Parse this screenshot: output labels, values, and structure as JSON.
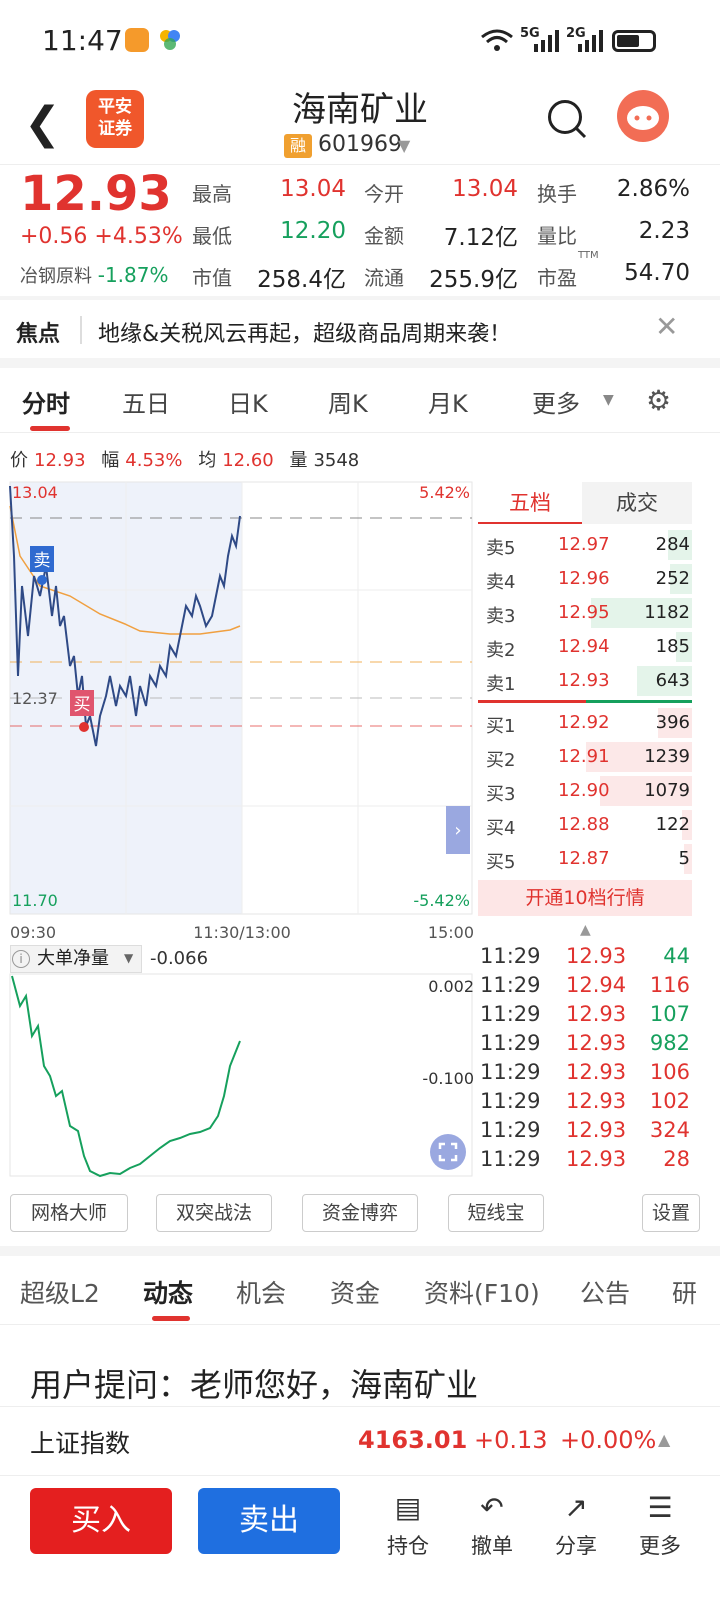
{
  "status": {
    "time": "11:47",
    "net1": "5G",
    "net2": "2G"
  },
  "header": {
    "logo_line1": "平安",
    "logo_line2": "证券",
    "title": "海南矿业",
    "rong": "融",
    "code": "601969"
  },
  "quote": {
    "price": "12.93",
    "change": "+0.56",
    "change_pct": "+4.53%",
    "sector_name": "冶钢原料",
    "sector_chg": "-1.87%",
    "high_label": "最高",
    "high": "13.04",
    "open_label": "今开",
    "open": "13.04",
    "turnover_label": "换手",
    "turnover": "2.86%",
    "low_label": "最低",
    "low": "12.20",
    "amount_label": "金额",
    "amount": "7.12亿",
    "vol_ratio_label": "量比",
    "vol_ratio": "2.23",
    "mcap_label": "市值",
    "mcap": "258.4亿",
    "float_label": "流通",
    "float": "255.9亿",
    "pe_label": "市盈",
    "pe_sup": "TTM",
    "pe": "54.70"
  },
  "news": {
    "label": "焦点",
    "text": "地缘&关税风云再起，超级商品周期来袭！"
  },
  "chart_tabs": [
    "分时",
    "五日",
    "日K",
    "周K",
    "月K",
    "更多"
  ],
  "info_row": {
    "price_label": "价",
    "price": "12.93",
    "amp_label": "幅",
    "amp": "4.53%",
    "avg_label": "均",
    "avg": "12.60",
    "vol_label": "量",
    "vol": "3548"
  },
  "chart_labels": {
    "top_price": "13.04",
    "top_pct": "5.42%",
    "mid_price": "12.37",
    "bottom_price": "11.70",
    "bottom_pct": "-5.42%",
    "t_start": "09:30",
    "t_mid": "11:30/13:00",
    "t_end": "15:00",
    "sell_mark": "卖",
    "buy_mark": "买"
  },
  "orderbook": {
    "tab_levels": "五档",
    "tab_trades": "成交",
    "asks": [
      {
        "label": "卖5",
        "price": "12.97",
        "vol": "284"
      },
      {
        "label": "卖4",
        "price": "12.96",
        "vol": "252"
      },
      {
        "label": "卖3",
        "price": "12.95",
        "vol": "1182"
      },
      {
        "label": "卖2",
        "price": "12.94",
        "vol": "185"
      },
      {
        "label": "卖1",
        "price": "12.93",
        "vol": "643"
      }
    ],
    "bids": [
      {
        "label": "买1",
        "price": "12.92",
        "vol": "396"
      },
      {
        "label": "买2",
        "price": "12.91",
        "vol": "1239"
      },
      {
        "label": "买3",
        "price": "12.90",
        "vol": "1079"
      },
      {
        "label": "买4",
        "price": "12.88",
        "vol": "122"
      },
      {
        "label": "买5",
        "price": "12.87",
        "vol": "5"
      }
    ],
    "open_level10": "开通10档行情"
  },
  "trades": [
    {
      "time": "11:29",
      "price": "12.93",
      "vol": "44",
      "color": "#16a05d"
    },
    {
      "time": "11:29",
      "price": "12.94",
      "vol": "116",
      "color": "#e0332f"
    },
    {
      "time": "11:29",
      "price": "12.93",
      "vol": "107",
      "color": "#16a05d"
    },
    {
      "time": "11:29",
      "price": "12.93",
      "vol": "982",
      "color": "#16a05d"
    },
    {
      "time": "11:29",
      "price": "12.93",
      "vol": "106",
      "color": "#e0332f"
    },
    {
      "time": "11:29",
      "price": "12.93",
      "vol": "102",
      "color": "#e0332f"
    },
    {
      "time": "11:29",
      "price": "12.93",
      "vol": "324",
      "color": "#e0332f"
    },
    {
      "time": "11:29",
      "price": "12.93",
      "vol": "28",
      "color": "#e0332f"
    }
  ],
  "indicator": {
    "name": "大单净量",
    "value": "-0.066",
    "top": "0.002",
    "mid": "-0.100"
  },
  "tools": [
    "网格大师",
    "双突战法",
    "资金博弈",
    "短线宝",
    "设置"
  ],
  "section_tabs": [
    "超级L2",
    "动态",
    "机会",
    "资金",
    "资料(F10)",
    "公告",
    "研"
  ],
  "question": "用户提问：老师您好，海南矿业",
  "index_bar": {
    "name": "上证指数",
    "value": "4163.01",
    "change": "+0.13",
    "pct": "+0.00%"
  },
  "bottom": {
    "buy": "买入",
    "sell": "卖出",
    "nav": [
      "持仓",
      "撤单",
      "分享",
      "更多"
    ]
  },
  "colors": {
    "up": "#e0332f",
    "down": "#16a05d",
    "buy_btn": "#e41f1f",
    "sell_btn": "#1f6fe0"
  }
}
